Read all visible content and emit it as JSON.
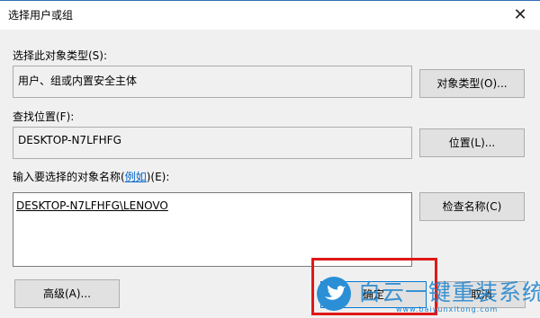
{
  "window": {
    "title": "选择用户或组",
    "close_glyph": "✕"
  },
  "object_type": {
    "label": "选择此对象类型(S):",
    "value": "用户、组或内置安全主体",
    "button": "对象类型(O)..."
  },
  "location": {
    "label": "查找位置(F):",
    "value": "DESKTOP-N7LFHFG",
    "button": "位置(L)..."
  },
  "names": {
    "label_prefix": "输入要选择的对象名称(",
    "label_link": "例如",
    "label_suffix": ")(E):",
    "value": "DESKTOP-N7LFHFG\\LENOVO",
    "button": "检查名称(C)"
  },
  "footer": {
    "advanced_button": "高级(A)...",
    "ok_button": "确定",
    "cancel_button": "取消"
  },
  "watermark": {
    "text": "白云一键重装系统",
    "url": "www.baiyunxitong.com",
    "icon": "bird-icon"
  }
}
